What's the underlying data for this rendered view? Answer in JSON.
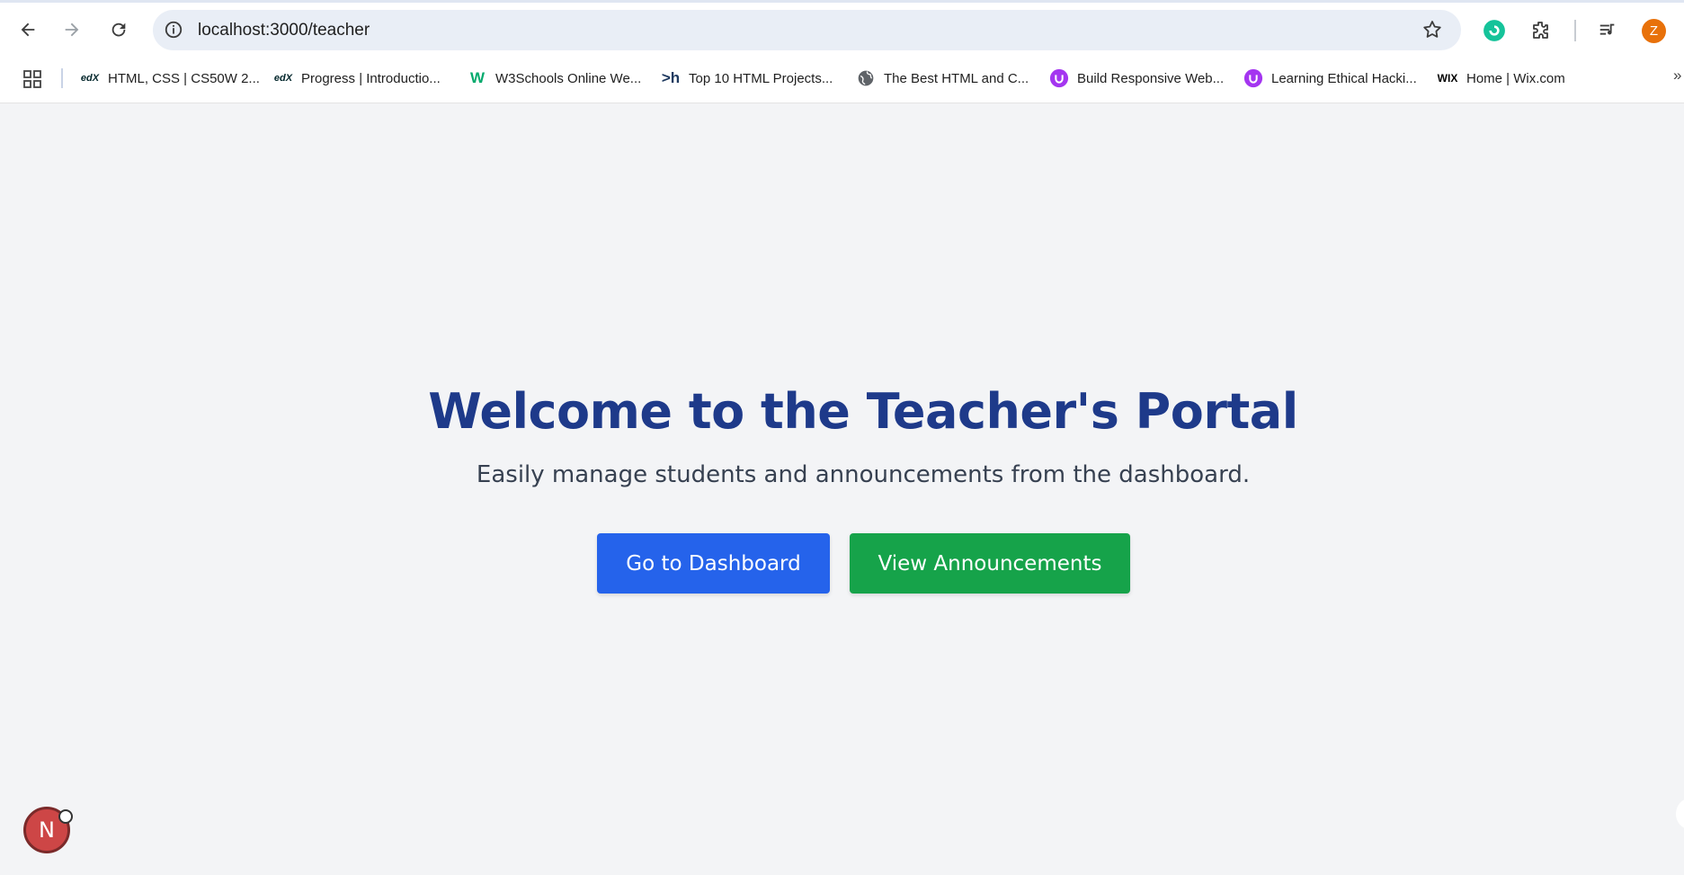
{
  "browser": {
    "url": "localhost:3000/teacher",
    "profile_initial": "Z",
    "bookmarks": [
      {
        "label": "HTML, CSS | CS50W 2...",
        "icon": "edx-icon"
      },
      {
        "label": "Progress | Introductio...",
        "icon": "edx-icon"
      },
      {
        "label": "W3Schools Online We...",
        "icon": "w3schools-icon"
      },
      {
        "label": "Top 10 HTML Projects...",
        "icon": "h-icon"
      },
      {
        "label": "The Best HTML and C...",
        "icon": "globe-icon"
      },
      {
        "label": "Build Responsive Web...",
        "icon": "udemy-icon"
      },
      {
        "label": "Learning Ethical Hacki...",
        "icon": "udemy-icon"
      },
      {
        "label": "Home | Wix.com",
        "icon": "wix-icon"
      }
    ],
    "bookmark_more": "»"
  },
  "page": {
    "title": "Welcome to the Teacher's Portal",
    "subtitle": "Easily manage students and announcements from the dashboard.",
    "primary_button": "Go to Dashboard",
    "secondary_button": "View Announcements",
    "dev_badge": "N"
  },
  "colors": {
    "title": "#1e3a8a",
    "primary_button": "#2563eb",
    "secondary_button": "#16a34a",
    "background": "#f3f4f6"
  }
}
